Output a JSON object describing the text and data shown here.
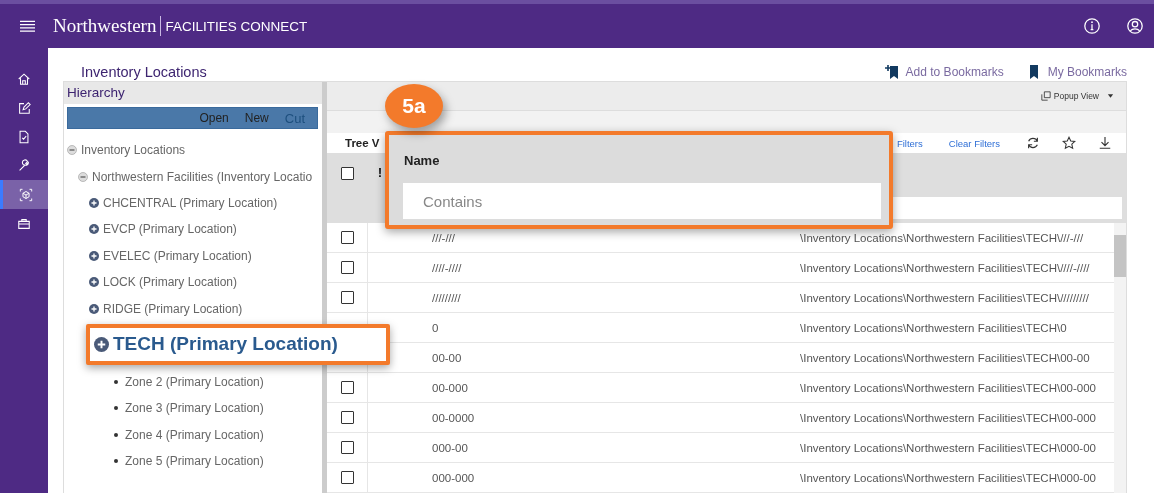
{
  "header": {
    "brand": "Northwestern",
    "product": "FACILITIES CONNECT"
  },
  "rail": [
    {
      "selected": false
    },
    {
      "selected": false
    },
    {
      "selected": false
    },
    {
      "selected": false
    },
    {
      "selected": true
    },
    {
      "selected": false
    }
  ],
  "page": {
    "title": "Inventory Locations",
    "links": [
      {
        "label": "Add to Bookmarks"
      },
      {
        "label": "My Bookmarks"
      }
    ]
  },
  "hierarchy": {
    "title": "Hierarchy",
    "actions": [
      {
        "label": "Open",
        "disabled": false
      },
      {
        "label": "New",
        "disabled": false
      },
      {
        "label": "Cut",
        "disabled": true
      }
    ],
    "tree": [
      {
        "label": "Inventory Locations",
        "expanded": true,
        "children": [
          {
            "label": "Northwestern Facilities (Inventory Locatio",
            "expanded": true,
            "children": [
              {
                "label": "CHCENTRAL (Primary Location)",
                "kind": "branch"
              },
              {
                "label": "EVCP (Primary Location)",
                "kind": "branch"
              },
              {
                "label": "EVELEC (Primary Location)",
                "kind": "branch"
              },
              {
                "label": "LOCK (Primary Location)",
                "kind": "branch"
              },
              {
                "label": "RIDGE (Primary Location)",
                "kind": "branch"
              },
              {
                "label": "TECH (Primary Location)",
                "kind": "callout"
              },
              {
                "label": "Zone 2 (Primary Location)",
                "kind": "leaf"
              },
              {
                "label": "Zone 3 (Primary Location)",
                "kind": "leaf"
              },
              {
                "label": "Zone 4 (Primary Location)",
                "kind": "leaf"
              },
              {
                "label": "Zone 5 (Primary Location)",
                "kind": "leaf"
              }
            ]
          }
        ]
      }
    ]
  },
  "grid": {
    "popup": "Popup View",
    "tab": "Tree V",
    "filters": "Filters",
    "clear_filters": "Clear Filters",
    "column_2": "!",
    "select_all_checked": false,
    "rows": [
      {
        "checked": false,
        "name": "///-///",
        "path": "\\Inventory Locations\\Northwestern Facilities\\TECH\\///-///"
      },
      {
        "checked": false,
        "name": "////-////",
        "path": "\\Inventory Locations\\Northwestern Facilities\\TECH\\////-////"
      },
      {
        "checked": false,
        "name": "/////////",
        "path": "\\Inventory Locations\\Northwestern Facilities\\TECH\\/////////"
      },
      {
        "name": "0",
        "path": "\\Inventory Locations\\Northwestern Facilities\\TECH\\0"
      },
      {
        "name": "00-00",
        "path": "\\Inventory Locations\\Northwestern Facilities\\TECH\\00-00"
      },
      {
        "checked": false,
        "name": "00-000",
        "path": "\\Inventory Locations\\Northwestern Facilities\\TECH\\00-000"
      },
      {
        "checked": false,
        "name": "00-0000",
        "path": "\\Inventory Locations\\Northwestern Facilities\\TECH\\00-000"
      },
      {
        "checked": false,
        "name": "000-00",
        "path": "\\Inventory Locations\\Northwestern Facilities\\TECH\\000-00"
      },
      {
        "checked": false,
        "name": "000-000",
        "path": "\\Inventory Locations\\Northwestern Facilities\\TECH\\000-00"
      }
    ]
  },
  "callout": {
    "step": "5a",
    "column": "Name",
    "placeholder": "Contains"
  }
}
